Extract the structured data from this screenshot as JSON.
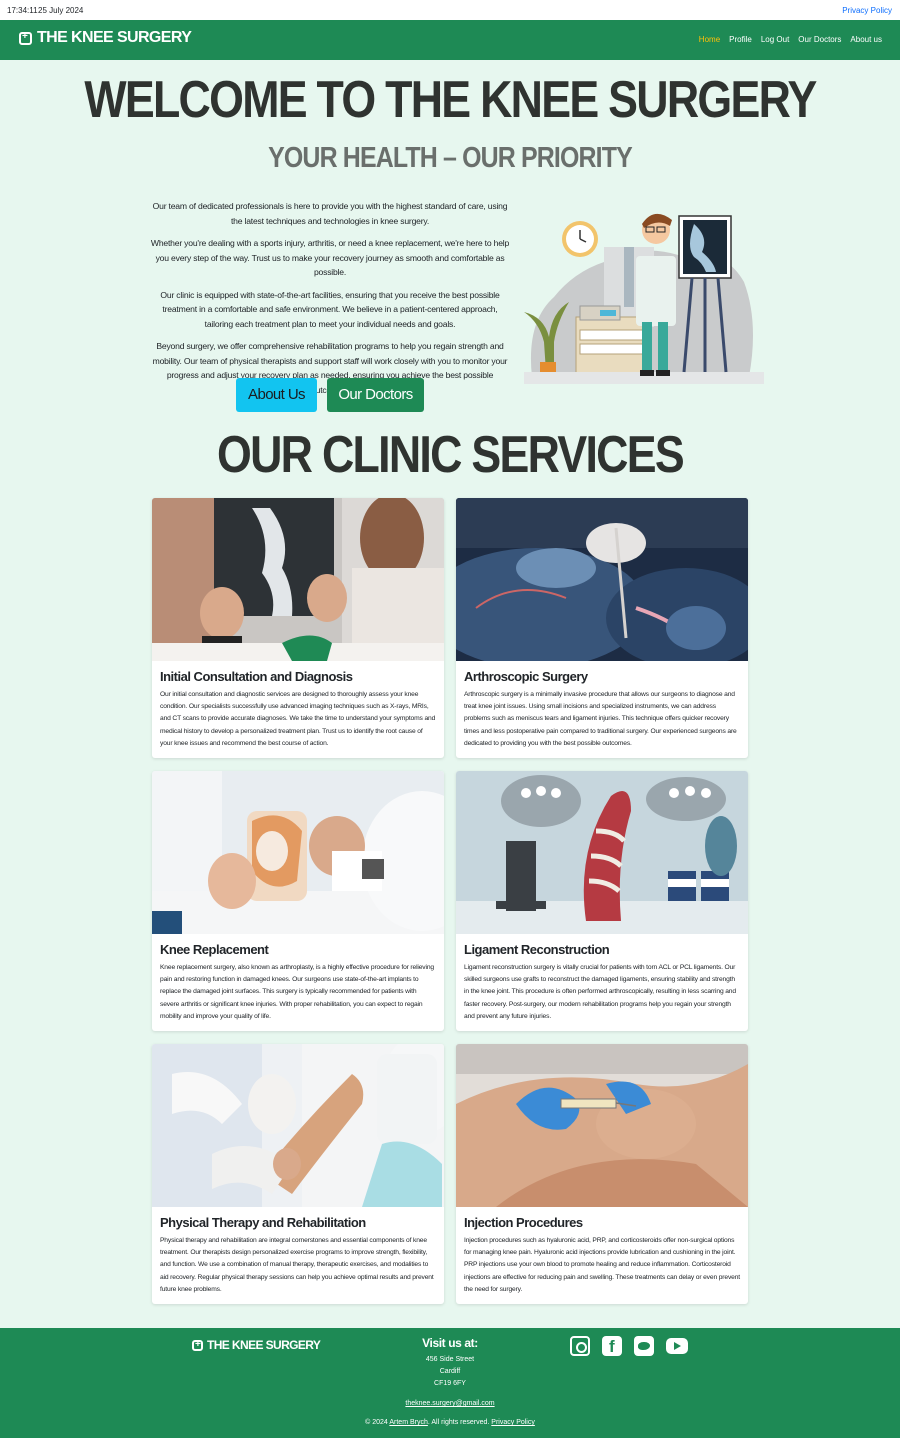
{
  "topbar": {
    "time": "17:34:11",
    "date": "25 July 2024",
    "privacy": "Privacy Policy"
  },
  "navbar": {
    "brand": "THE KNEE SURGERY",
    "links": [
      "Home",
      "Profile",
      "Log Out",
      "Our Doctors",
      "About us"
    ]
  },
  "hero": {
    "title": "WELCOME TO THE KNEE SURGERY",
    "subtitle": "YOUR HEALTH – OUR PRIORITY",
    "paragraphs": [
      "Our team of dedicated professionals is here to provide you with the highest standard of care, using the latest techniques and technologies in knee surgery.",
      "Whether you're dealing with a sports injury, arthritis, or need a knee replacement, we're here to help you every step of the way. Trust us to make your recovery journey as smooth and comfortable as possible.",
      "Our clinic is equipped with state-of-the-art facilities, ensuring that you receive the best possible treatment in a comfortable and safe environment. We believe in a patient-centered approach, tailoring each treatment plan to meet your individual needs and goals.",
      "Beyond surgery, we offer comprehensive rehabilitation programs to help you regain strength and mobility. Our team of physical therapists and support staff will work closely with you to monitor your progress and adjust your recovery plan as needed, ensuring you achieve the best possible outcomes."
    ],
    "about_btn": "About Us",
    "doctors_btn": "Our Doctors"
  },
  "services": {
    "title": "OUR CLINIC SERVICES",
    "cards": [
      {
        "title": "Initial Consultation and Diagnosis",
        "body": "Our initial consultation and diagnostic services are designed to thoroughly assess your knee condition. Our specialists successfully use advanced imaging techniques such as X-rays, MRIs, and CT scans to provide accurate diagnoses. We take the time to understand your symptoms and medical history to develop a personalized treatment plan. Trust us to identify the root cause of your knee issues and recommend the best course of action."
      },
      {
        "title": "Arthroscopic Surgery",
        "body": "Arthroscopic surgery is a minimally invasive procedure that allows our surgeons to diagnose and treat knee joint issues. Using small incisions and specialized instruments, we can address problems such as meniscus tears and ligament injuries. This technique offers quicker recovery times and less postoperative pain compared to traditional surgery. Our experienced surgeons are dedicated to providing you with the best possible outcomes."
      },
      {
        "title": "Knee Replacement",
        "body": "Knee replacement surgery, also known as arthroplasty, is a highly effective procedure for relieving pain and restoring function in damaged knees. Our surgeons use state-of-the-art implants to replace the damaged joint surfaces. This surgery is typically recommended for patients with severe arthritis or significant knee injuries. With proper rehabilitation, you can expect to regain mobility and improve your quality of life."
      },
      {
        "title": "Ligament Reconstruction",
        "body": "Ligament reconstruction surgery is vitally crucial for patients with torn ACL or PCL ligaments. Our skilled surgeons use grafts to reconstruct the damaged ligaments, ensuring stability and strength in the knee joint. This procedure is often performed arthroscopically, resulting in less scarring and faster recovery. Post-surgery, our modern rehabilitation programs help you regain your strength and prevent any future injuries."
      },
      {
        "title": "Physical Therapy and Rehabilitation",
        "body": "Physical therapy and rehabilitation are integral cornerstones and essential components of knee treatment. Our therapists design personalized exercise programs to improve strength, flexibility, and function. We use a combination of manual therapy, therapeutic exercises, and modalities to aid recovery. Regular physical therapy sessions can help you achieve optimal results and prevent future knee problems."
      },
      {
        "title": "Injection Procedures",
        "body": "Injection procedures such as hyaluronic acid, PRP, and corticosteroids offer non-surgical options for managing knee pain. Hyaluronic acid injections provide lubrication and cushioning in the joint. PRP injections use your own blood to promote healing and reduce inflammation. Corticosteroid injections are effective for reducing pain and swelling. These treatments can delay or even prevent the need for surgery."
      }
    ]
  },
  "footer": {
    "brand": "THE KNEE SURGERY",
    "visit_title": "Visit us at:",
    "address": [
      "456 Side Street",
      "Cardiff",
      "CF19 6FY"
    ],
    "email": "theknee.surgery@gmail.com",
    "copy_prefix": "© 2024",
    "author": "Artem Brych",
    "copy_suffix": ". All rights reserved.",
    "privacy": "Privacy Policy"
  },
  "colors": {
    "nav": "#1e8a55",
    "bg": "#e7f7ef",
    "active": "#ffc107",
    "about_btn": "#12c4f0"
  },
  "icons": [
    "instagram-icon",
    "facebook-icon",
    "twitter-icon",
    "youtube-icon"
  ]
}
